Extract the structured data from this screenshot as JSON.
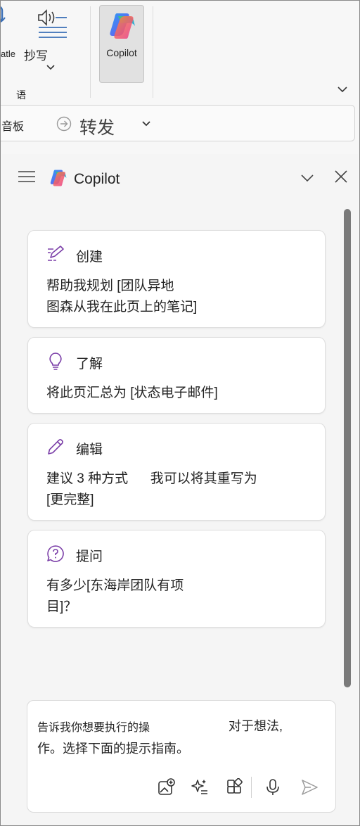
{
  "ribbon": {
    "partial_label": "atle",
    "dictate_label": "抄写",
    "group_label": "语",
    "copilot_label": "Copilot"
  },
  "toolbar": {
    "clipboard_partial": "音板",
    "forward_label": "转发"
  },
  "pane": {
    "title": "Copilot"
  },
  "cards": [
    {
      "title": "创建",
      "icon": "compose-pen-icon",
      "line1": "帮助我规划 [团队异地",
      "line2": "图森从我在此页上的笔记]"
    },
    {
      "title": "了解",
      "icon": "lightbulb-icon",
      "line1": "将此页汇总为 [状态电子邮件]"
    },
    {
      "title": "编辑",
      "icon": "pencil-icon",
      "line1": "建议 3 种方式      我可以将其重写为",
      "line2": "[更完整]"
    },
    {
      "title": "提问",
      "icon": "question-bubble-icon",
      "line1": "有多少[东海岸团队有项",
      "line2": "目]？"
    }
  ],
  "composer": {
    "placeholder_line1a": "告诉我你想要执行的操",
    "placeholder_line1b": "对于想法,",
    "placeholder_line2": "作。选择下面的提示指南。"
  },
  "colors": {
    "accent_purple": "#7b3fa8",
    "pane_bg": "#f5f5f5",
    "card_bg": "#ffffff"
  }
}
